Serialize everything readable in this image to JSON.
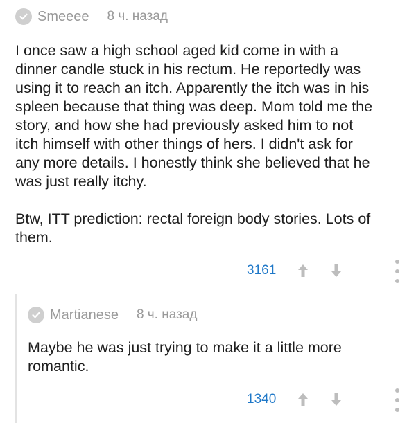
{
  "comments": [
    {
      "author": "Smeeee",
      "time": "8 ч. назад",
      "text": "I once saw a high school aged kid come in with a\ndinner candle stuck in his rectum. He reportedly was\nusing it to reach an itch. Apparently the itch was in his\nspleen because that thing was deep. Mom told me the\nstory, and how she had previously asked him to not\nitch himself with other things of hers. I didn't ask for\nany more details. I honestly think she believed that he\nwas just really itchy.\n\nBtw, ITT prediction: rectal foreign body stories. Lots of\nthem.",
      "score": "3161"
    },
    {
      "author": "Martianese",
      "time": "8 ч. назад",
      "text": "Maybe he was just trying to make it a little more\nromantic.",
      "score": "1340"
    }
  ],
  "colors": {
    "score": "#1f78c8",
    "meta": "#9a9a9a",
    "icon": "#cfcfcf"
  },
  "icons": {
    "verified": "check-circle-icon",
    "upvote": "arrow-up-icon",
    "downvote": "arrow-down-icon",
    "more": "more-vertical-icon"
  }
}
